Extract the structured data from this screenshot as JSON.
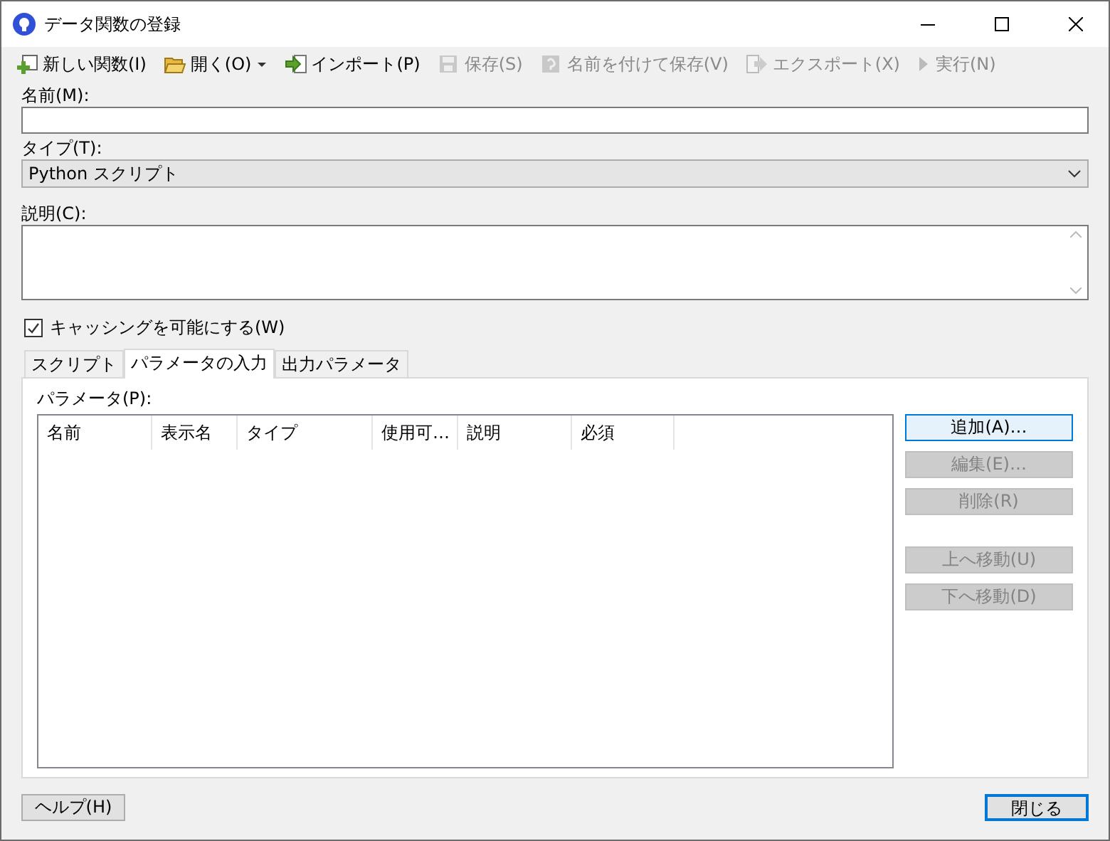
{
  "window": {
    "title": "データ関数の登録"
  },
  "toolbar": [
    {
      "label": "新しい関数(I)",
      "disabled": false,
      "dropdown": false
    },
    {
      "label": "開く(O)",
      "disabled": false,
      "dropdown": true
    },
    {
      "label": "インポート(P)",
      "disabled": false,
      "dropdown": false
    },
    {
      "label": "保存(S)",
      "disabled": true,
      "dropdown": false
    },
    {
      "label": "名前を付けて保存(V)",
      "disabled": true,
      "dropdown": false
    },
    {
      "label": "エクスポート(X)",
      "disabled": true,
      "dropdown": false
    },
    {
      "label": "実行(N)",
      "disabled": true,
      "dropdown": false
    }
  ],
  "name": {
    "label": "名前(M):"
  },
  "type": {
    "label": "タイプ(T):",
    "value": "Python スクリプト"
  },
  "description": {
    "label": "説明(C):"
  },
  "caching": {
    "label": "キャッシングを可能にする(W)",
    "checked": true
  },
  "tabs": [
    {
      "label": "スクリプト",
      "selected": false
    },
    {
      "label": "パラメータの入力",
      "selected": true
    },
    {
      "label": "出力パラメータ",
      "selected": false
    }
  ],
  "parameters": {
    "label": "パラメータ(P):",
    "columns": [
      "名前",
      "表示名",
      "タイプ",
      "使用可…",
      "説明",
      "必須"
    ]
  },
  "side_buttons": [
    {
      "label": "追加(A)…",
      "disabled": false,
      "default": true
    },
    {
      "label": "編集(E)…",
      "disabled": true,
      "default": false
    },
    {
      "label": "削除(R)",
      "disabled": true,
      "default": false
    },
    {
      "label": "上へ移動(U)",
      "disabled": true,
      "default": false
    },
    {
      "label": "下へ移動(D)",
      "disabled": true,
      "default": false
    }
  ],
  "footer": {
    "help": "ヘルプ(H)",
    "close": "閉じる"
  }
}
